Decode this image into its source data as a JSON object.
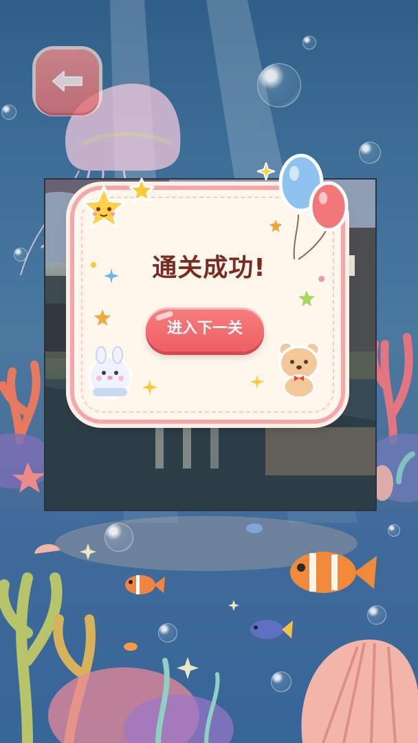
{
  "dialog": {
    "title": "通关成功!",
    "next_button_label": "进入下一关"
  },
  "icons": {
    "back": "arrow-left-icon",
    "stars": "star-icon",
    "balloons": "balloon-icon",
    "bear": "bear-sticker-icon",
    "bunny": "bunny-sticker-icon"
  },
  "colors": {
    "ocean": "#3c6d96",
    "accent_pink": "#ee5f63",
    "card_bg": "#fff6ec",
    "card_border": "#f7a7ab",
    "title": "#7a2a1e"
  }
}
